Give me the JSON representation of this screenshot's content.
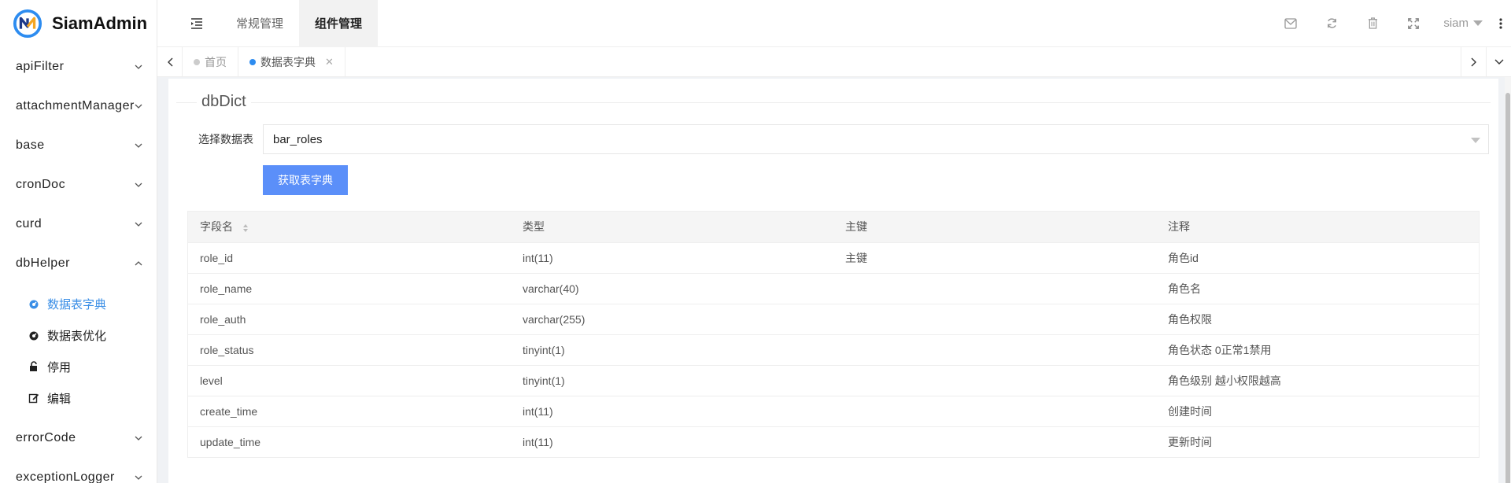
{
  "brand": {
    "name": "SiamAdmin"
  },
  "sidebar": {
    "items": [
      {
        "label": "apiFilter"
      },
      {
        "label": "attachmentManager"
      },
      {
        "label": "base"
      },
      {
        "label": "cronDoc"
      },
      {
        "label": "curd"
      },
      {
        "label": "dbHelper"
      },
      {
        "label": "errorCode"
      },
      {
        "label": "exceptionLogger"
      }
    ],
    "dbHelper_children": [
      {
        "label": "数据表字典",
        "active": true
      },
      {
        "label": "数据表优化"
      },
      {
        "label": "停用"
      },
      {
        "label": "编辑"
      }
    ]
  },
  "header": {
    "tabs": [
      {
        "label": "常规管理"
      },
      {
        "label": "组件管理",
        "active": true
      }
    ],
    "user": "siam"
  },
  "page_tabs": [
    {
      "label": "首页"
    },
    {
      "label": "数据表字典",
      "active": true
    }
  ],
  "main": {
    "section_title": "dbDict",
    "select_label": "选择数据表",
    "select_value": "bar_roles",
    "button_label": "获取表字典",
    "table": {
      "columns": [
        "字段名",
        "类型",
        "主键",
        "注释"
      ],
      "rows": [
        [
          "role_id",
          "int(11)",
          "主键",
          "角色id"
        ],
        [
          "role_name",
          "varchar(40)",
          "",
          "角色名"
        ],
        [
          "role_auth",
          "varchar(255)",
          "",
          "角色权限"
        ],
        [
          "role_status",
          "tinyint(1)",
          "",
          "角色状态 0正常1禁用"
        ],
        [
          "level",
          "tinyint(1)",
          "",
          "角色级别 越小权限越高"
        ],
        [
          "create_time",
          "int(11)",
          "",
          "创建时间"
        ],
        [
          "update_time",
          "int(11)",
          "",
          "更新时间"
        ]
      ]
    }
  },
  "colors": {
    "accent": "#5b8ff9",
    "active_link": "#3a8ee6",
    "active_dot": "#2d8cf0"
  }
}
